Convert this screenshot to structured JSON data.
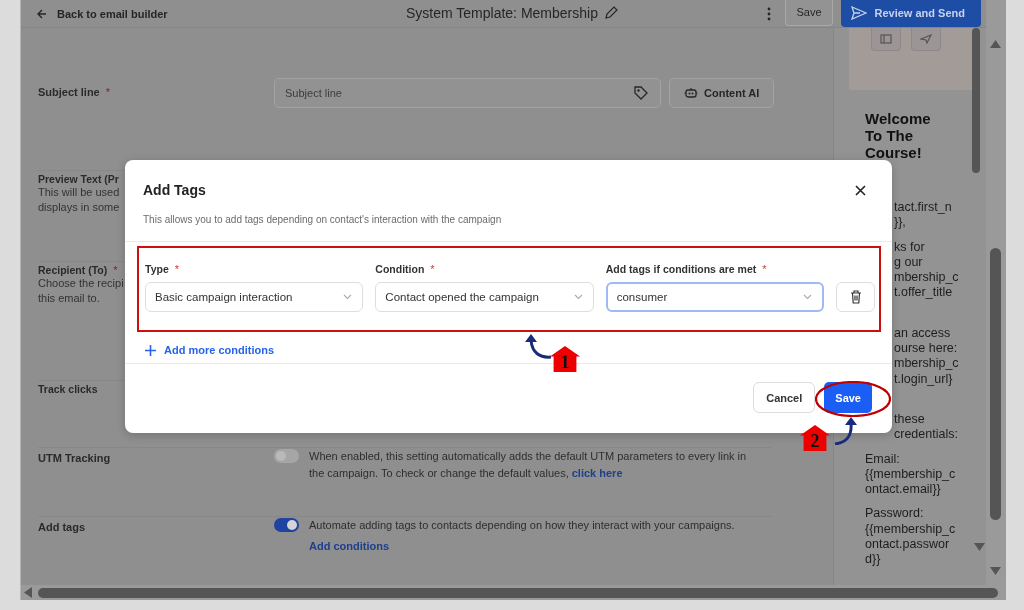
{
  "top_bar": {
    "back_link": "Back to email builder",
    "title": "System Template: Membership",
    "save_button": "Save",
    "review_button": "Review and Send"
  },
  "settings": [
    {
      "kind": "subject",
      "label": "Subject line",
      "marker": "*",
      "placeholder": "Subject line",
      "ai_button": "Content AI"
    },
    {
      "kind": "text",
      "label": "Preview Text (Pr",
      "description_lines": [
        "This will be used",
        "displays in some"
      ]
    },
    {
      "kind": "text",
      "label": "Recipient (To)",
      "marker": "*",
      "description_lines": [
        "Choose the recipi",
        "this email to."
      ]
    },
    {
      "kind": "text",
      "label": "Track clicks"
    },
    {
      "kind": "toggle",
      "label": "UTM Tracking",
      "on": false,
      "description": "When enabled, this setting automatically adds the default UTM parameters to every link in the campaign. To check or change the default values,",
      "link": "click here"
    },
    {
      "kind": "toggle",
      "label": "Add tags",
      "on": true,
      "description": "Automate adding tags to contacts depending on how they interact with your campaigns.",
      "action_link": "Add conditions"
    }
  ],
  "preview": {
    "heading": "Welcome To The Course!",
    "paragraphs": [
      {
        "kind": "clipped",
        "lines": [
          "tact.first_n",
          "}},"
        ]
      },
      {
        "kind": "clipped",
        "lines": [
          "ks for",
          "g our",
          "mbership_c",
          "t.offer_title"
        ]
      },
      {
        "kind": "clipped",
        "lines": [
          "an access",
          "ourse here:",
          "mbership_c",
          "t.login_url}"
        ]
      },
      {
        "kind": "clipped",
        "lines": [
          "these",
          "credentials:"
        ]
      },
      {
        "kind": "full",
        "lines": [
          "Email:",
          "{{membership_c",
          "ontact.email}}"
        ]
      },
      {
        "kind": "full",
        "lines": [
          "Password:",
          "{{membership_c",
          "ontact.passwor",
          "d}}"
        ]
      }
    ]
  },
  "modal": {
    "title": "Add Tags",
    "description": "This allows you to add tags depending on contact's interaction with the campaign",
    "fields": [
      {
        "label": "Type",
        "marker": "*",
        "value": "Basic campaign interaction",
        "focused": false
      },
      {
        "label": "Condition",
        "marker": "*",
        "value": "Contact opened the campaign",
        "focused": false
      },
      {
        "label": "Add tags if conditions are met",
        "marker": "*",
        "value": "consumer",
        "focused": true
      }
    ],
    "add_more": "Add more conditions",
    "cancel_button": "Cancel",
    "save_button": "Save"
  },
  "annotations": {
    "steps": [
      {
        "number": "1"
      },
      {
        "number": "2"
      }
    ]
  }
}
